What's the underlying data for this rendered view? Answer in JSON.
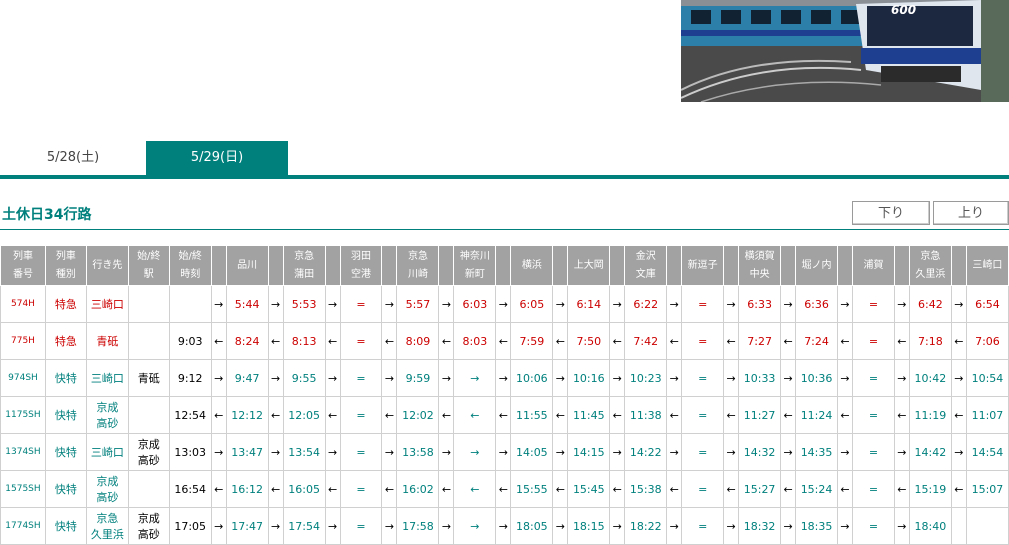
{
  "tabs": [
    "5/28(土)",
    "5/29(日)"
  ],
  "route_title": "土休日34行路",
  "buttons": {
    "down": "下り",
    "up": "上り"
  },
  "headers": [
    [
      "列車",
      "番号"
    ],
    [
      "列車",
      "種別"
    ],
    [
      "行き先"
    ],
    [
      "始/終",
      "駅"
    ],
    [
      "始/終",
      "時刻"
    ],
    [
      ""
    ],
    [
      "品川"
    ],
    [
      ""
    ],
    [
      "京急",
      "蒲田"
    ],
    [
      ""
    ],
    [
      "羽田",
      "空港"
    ],
    [
      ""
    ],
    [
      "京急",
      "川崎"
    ],
    [
      ""
    ],
    [
      "神奈川",
      "新町"
    ],
    [
      ""
    ],
    [
      "横浜"
    ],
    [
      ""
    ],
    [
      "上大岡"
    ],
    [
      ""
    ],
    [
      "金沢",
      "文庫"
    ],
    [
      ""
    ],
    [
      "新逗子"
    ],
    [
      ""
    ],
    [
      "横須賀",
      "中央"
    ],
    [
      ""
    ],
    [
      "堀ノ内"
    ],
    [
      ""
    ],
    [
      "浦賀"
    ],
    [
      ""
    ],
    [
      "京急",
      "久里浜"
    ],
    [
      ""
    ],
    [
      "三崎口"
    ]
  ],
  "rows": [
    {
      "color": "red",
      "no": "574H",
      "type": "特急",
      "dest": "三崎口",
      "end_sta": "",
      "end_time": "",
      "cells": [
        "→",
        "5:44",
        "→",
        "5:53",
        "→",
        "=",
        "→",
        "5:57",
        "→",
        "6:03",
        "→",
        "6:05",
        "→",
        "6:14",
        "→",
        "6:22",
        "→",
        "=",
        "→",
        "6:33",
        "→",
        "6:36",
        "→",
        "=",
        "→",
        "6:42",
        "→",
        "6:54"
      ]
    },
    {
      "color": "red",
      "no": "775H",
      "type": "特急",
      "dest": "青砥",
      "end_sta": "",
      "end_time": "9:03",
      "cells": [
        "←",
        "8:24",
        "←",
        "8:13",
        "←",
        "=",
        "←",
        "8:09",
        "←",
        "8:03",
        "←",
        "7:59",
        "←",
        "7:50",
        "←",
        "7:42",
        "←",
        "=",
        "←",
        "7:27",
        "←",
        "7:24",
        "←",
        "=",
        "←",
        "7:18",
        "←",
        "7:06"
      ]
    },
    {
      "color": "grn",
      "no": "974SH",
      "type": "快特",
      "dest": "三崎口",
      "end_sta": "青砥",
      "end_time": "9:12",
      "cells": [
        "→",
        "9:47",
        "→",
        "9:55",
        "→",
        "=",
        "→",
        "9:59",
        "→",
        "→",
        "→",
        "10:06",
        "→",
        "10:16",
        "→",
        "10:23",
        "→",
        "=",
        "→",
        "10:33",
        "→",
        "10:36",
        "→",
        "=",
        "→",
        "10:42",
        "→",
        "10:54"
      ]
    },
    {
      "color": "grn",
      "no": "1175SH",
      "type": "快特",
      "dest": "京成\n高砂",
      "end_sta": "",
      "end_time": "12:54",
      "cells": [
        "←",
        "12:12",
        "←",
        "12:05",
        "←",
        "=",
        "←",
        "12:02",
        "←",
        "←",
        "←",
        "11:55",
        "←",
        "11:45",
        "←",
        "11:38",
        "←",
        "=",
        "←",
        "11:27",
        "←",
        "11:24",
        "←",
        "=",
        "←",
        "11:19",
        "←",
        "11:07"
      ]
    },
    {
      "color": "grn",
      "no": "1374SH",
      "type": "快特",
      "dest": "三崎口",
      "end_sta": "京成\n高砂",
      "end_time": "13:03",
      "cells": [
        "→",
        "13:47",
        "→",
        "13:54",
        "→",
        "=",
        "→",
        "13:58",
        "→",
        "→",
        "→",
        "14:05",
        "→",
        "14:15",
        "→",
        "14:22",
        "→",
        "=",
        "→",
        "14:32",
        "→",
        "14:35",
        "→",
        "=",
        "→",
        "14:42",
        "→",
        "14:54"
      ]
    },
    {
      "color": "grn",
      "no": "1575SH",
      "type": "快特",
      "dest": "京成\n高砂",
      "end_sta": "",
      "end_time": "16:54",
      "cells": [
        "←",
        "16:12",
        "←",
        "16:05",
        "←",
        "=",
        "←",
        "16:02",
        "←",
        "←",
        "←",
        "15:55",
        "←",
        "15:45",
        "←",
        "15:38",
        "←",
        "=",
        "←",
        "15:27",
        "←",
        "15:24",
        "←",
        "=",
        "←",
        "15:19",
        "←",
        "15:07"
      ]
    },
    {
      "color": "grn",
      "no": "1774SH",
      "type": "快特",
      "dest": "京急\n久里浜",
      "end_sta": "京成\n高砂",
      "end_time": "17:05",
      "cells": [
        "→",
        "17:47",
        "→",
        "17:54",
        "→",
        "=",
        "→",
        "17:58",
        "→",
        "→",
        "→",
        "18:05",
        "→",
        "18:15",
        "→",
        "18:22",
        "→",
        "=",
        "→",
        "18:32",
        "→",
        "18:35",
        "→",
        "=",
        "→",
        "18:40",
        "",
        ""
      ]
    }
  ]
}
